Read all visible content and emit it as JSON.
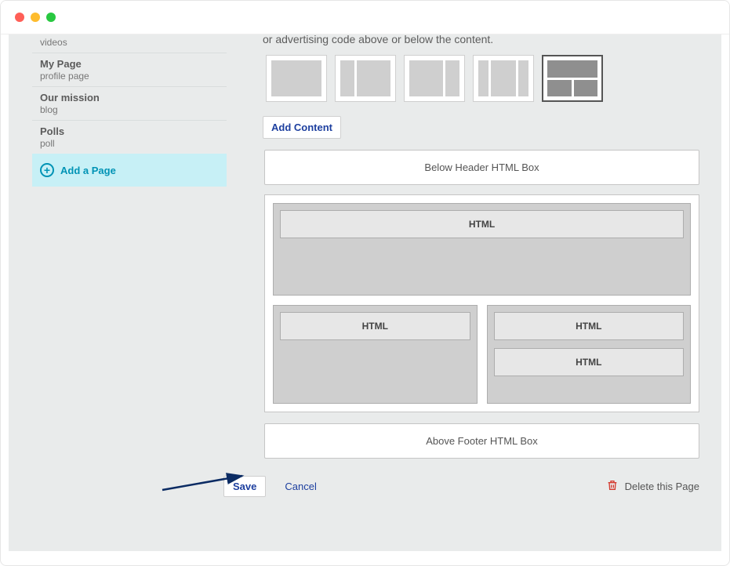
{
  "sidebar": {
    "items": [
      {
        "title": "",
        "sub": "videos"
      },
      {
        "title": "My Page",
        "sub": "profile page"
      },
      {
        "title": "Our mission",
        "sub": "blog"
      },
      {
        "title": "Polls",
        "sub": "poll"
      }
    ],
    "add_page_label": "Add a Page"
  },
  "main": {
    "truncated_text": "or advertising code above or below the content.",
    "add_content_label": "Add Content",
    "below_header_label": "Below Header HTML Box",
    "above_footer_label": "Above Footer HTML Box",
    "html_label": "HTML"
  },
  "actions": {
    "save": "Save",
    "cancel": "Cancel",
    "delete": "Delete this Page"
  }
}
